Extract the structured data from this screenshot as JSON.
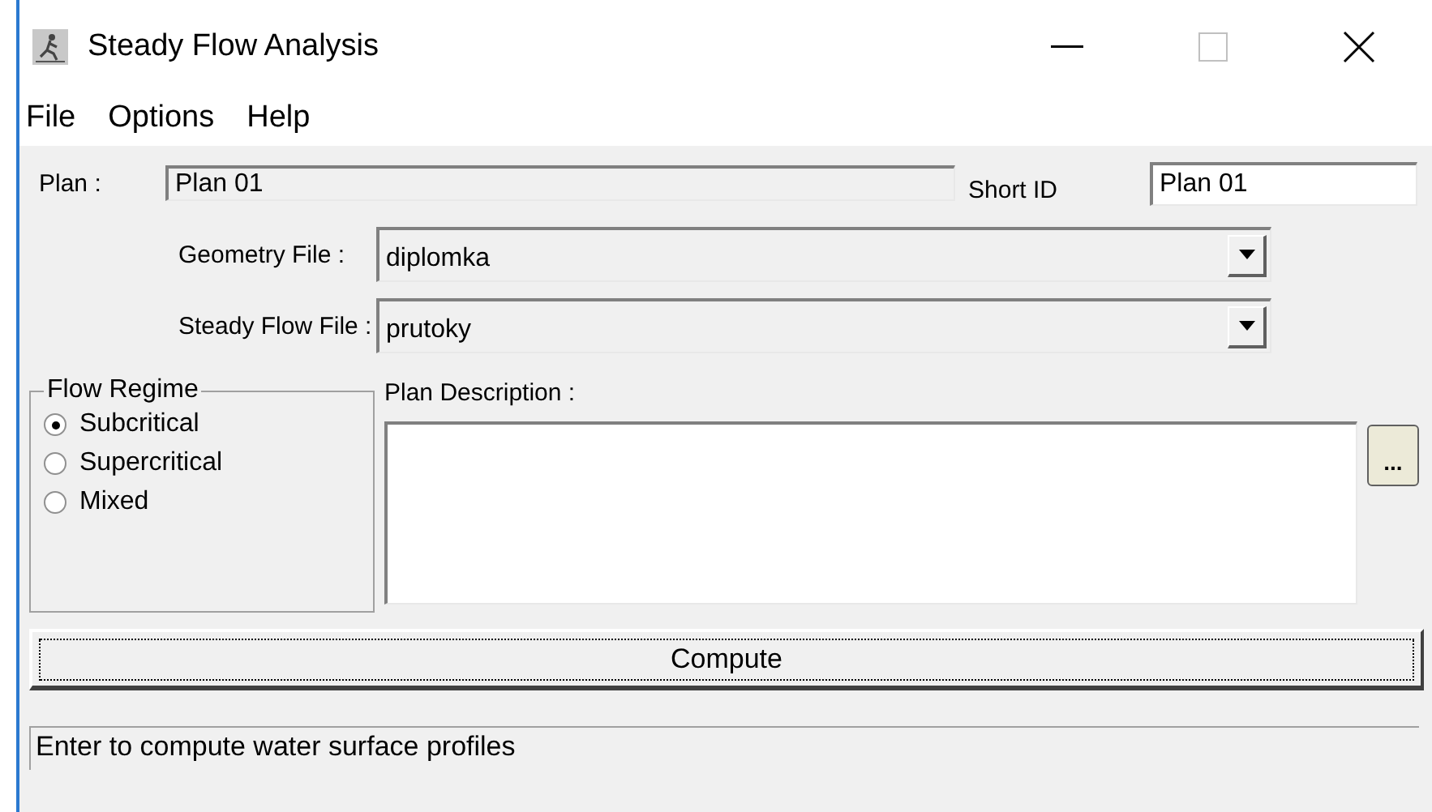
{
  "window": {
    "title": "Steady Flow Analysis"
  },
  "menu": [
    "File",
    "Options",
    "Help"
  ],
  "plan": {
    "label": "Plan :",
    "value": "Plan 01"
  },
  "short_id": {
    "label": "Short ID",
    "value": "Plan 01"
  },
  "files": [
    {
      "label": "Geometry File :",
      "value": "diplomka"
    },
    {
      "label": "Steady Flow File :",
      "value": "prutoky"
    }
  ],
  "flow_regime": {
    "title": "Flow Regime",
    "options": [
      {
        "label": "Subcritical",
        "selected": true
      },
      {
        "label": "Supercritical",
        "selected": false
      },
      {
        "label": "Mixed",
        "selected": false
      }
    ]
  },
  "plan_description": {
    "label": "Plan Description :",
    "browse_button": "..."
  },
  "compute_button": "Compute",
  "status_bar": "Enter to compute water surface profiles"
}
